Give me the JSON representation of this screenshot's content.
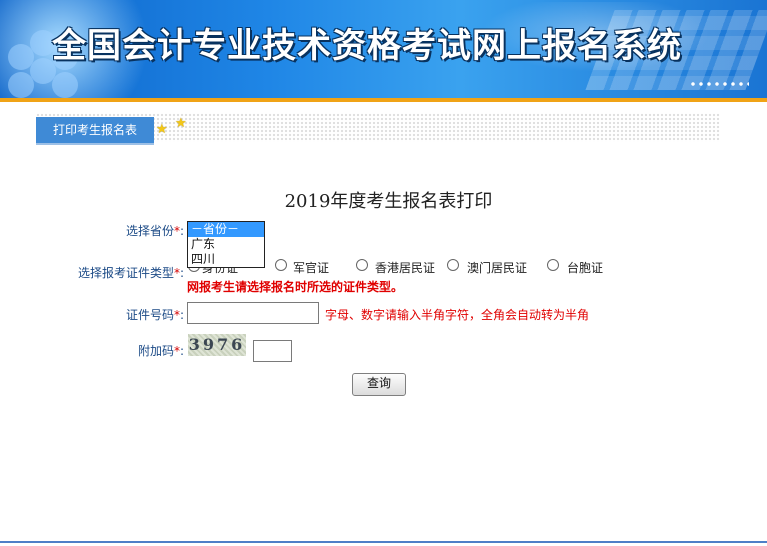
{
  "banner": {
    "title": "全国会计专业技术资格考试网上报名系统"
  },
  "tab": {
    "label": "打印考生报名表"
  },
  "form": {
    "heading": "2019年度考生报名表打印",
    "province": {
      "label": "选择省份",
      "required": "*",
      "colon": ":",
      "options": [
        "－省份－",
        "广东",
        "四川"
      ],
      "selected": "－省份－"
    },
    "id_type": {
      "label": "选择报考证件类型",
      "required": "*",
      "colon": ":",
      "options": [
        "身份证",
        "军官证",
        "香港居民证",
        "澳门居民证",
        "台胞证"
      ],
      "notice": "网报考生请选择报名时所选的证件类型。"
    },
    "id_number": {
      "label": "证件号码",
      "required": "*",
      "colon": ":",
      "value": "",
      "hint": "字母、数字请输入半角字符，全角会自动转为半角"
    },
    "captcha": {
      "label": "附加码",
      "required": "*",
      "colon": ":",
      "image_text": "3976",
      "value": ""
    },
    "submit_label": "查询"
  }
}
